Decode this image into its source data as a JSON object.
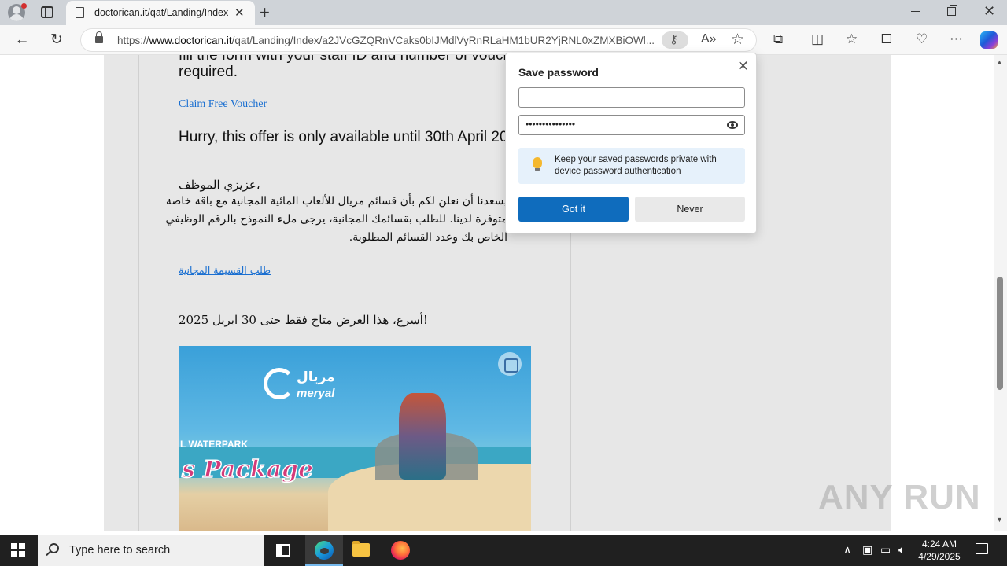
{
  "browser": {
    "tab_title": "doctorican.it/qat/Landing/Index",
    "tab_close": "✕",
    "new_tab": "+",
    "url_prefix": "https://",
    "url_domain": "www.doctorican.it",
    "url_path": "/qat/Landing/Index/a2JVcGZQRnVCaks0bIJMdlVyRnRLaHM1bUR2YjRNL0xZMXBiOWl...",
    "back": "←",
    "refresh": "↻",
    "read_aloud": "A»",
    "favorite": "☆"
  },
  "email": {
    "cut_line": "fill the form with your staff ID and number of vouchers",
    "required": "required.",
    "claim_link": "Claim Free Voucher",
    "hurry": "Hurry, this offer is only available until 30th April 2025!",
    "ar_greeting": "عزيزي الموظف،",
    "ar_line1": "يسعدنا أن نعلن لكم بأن قسائم مريال للألعاب المائية المجانية مع باقة خاصة",
    "ar_line2": "متوفرة لدينا. للطلب بقسائمك المجانية، يرجى ملء النموذج بالرقم الوظيفي",
    "ar_line3": "الخاص بك وعدد القسائم المطلوبة.",
    "ar_link": "طلب القسيمة المجانية",
    "ar_hurry": "أسرع، هذا العرض متاح فقط حتى 30 ابريل 2025!",
    "banner_brand_ar": "مريال",
    "banner_brand": "meryal",
    "banner_waterpark": "L WATERPARK",
    "banner_package": "s Package"
  },
  "popup": {
    "title": "Save password",
    "close": "✕",
    "username_value": "",
    "password_value": "•••••••••••••••",
    "tip": "Keep your saved passwords private with device password authentication",
    "got_it": "Got it",
    "never": "Never"
  },
  "watermark": "ANY RUN",
  "taskbar": {
    "search_placeholder": "Type here to search",
    "time": "4:24 AM",
    "date": "4/29/2025"
  }
}
